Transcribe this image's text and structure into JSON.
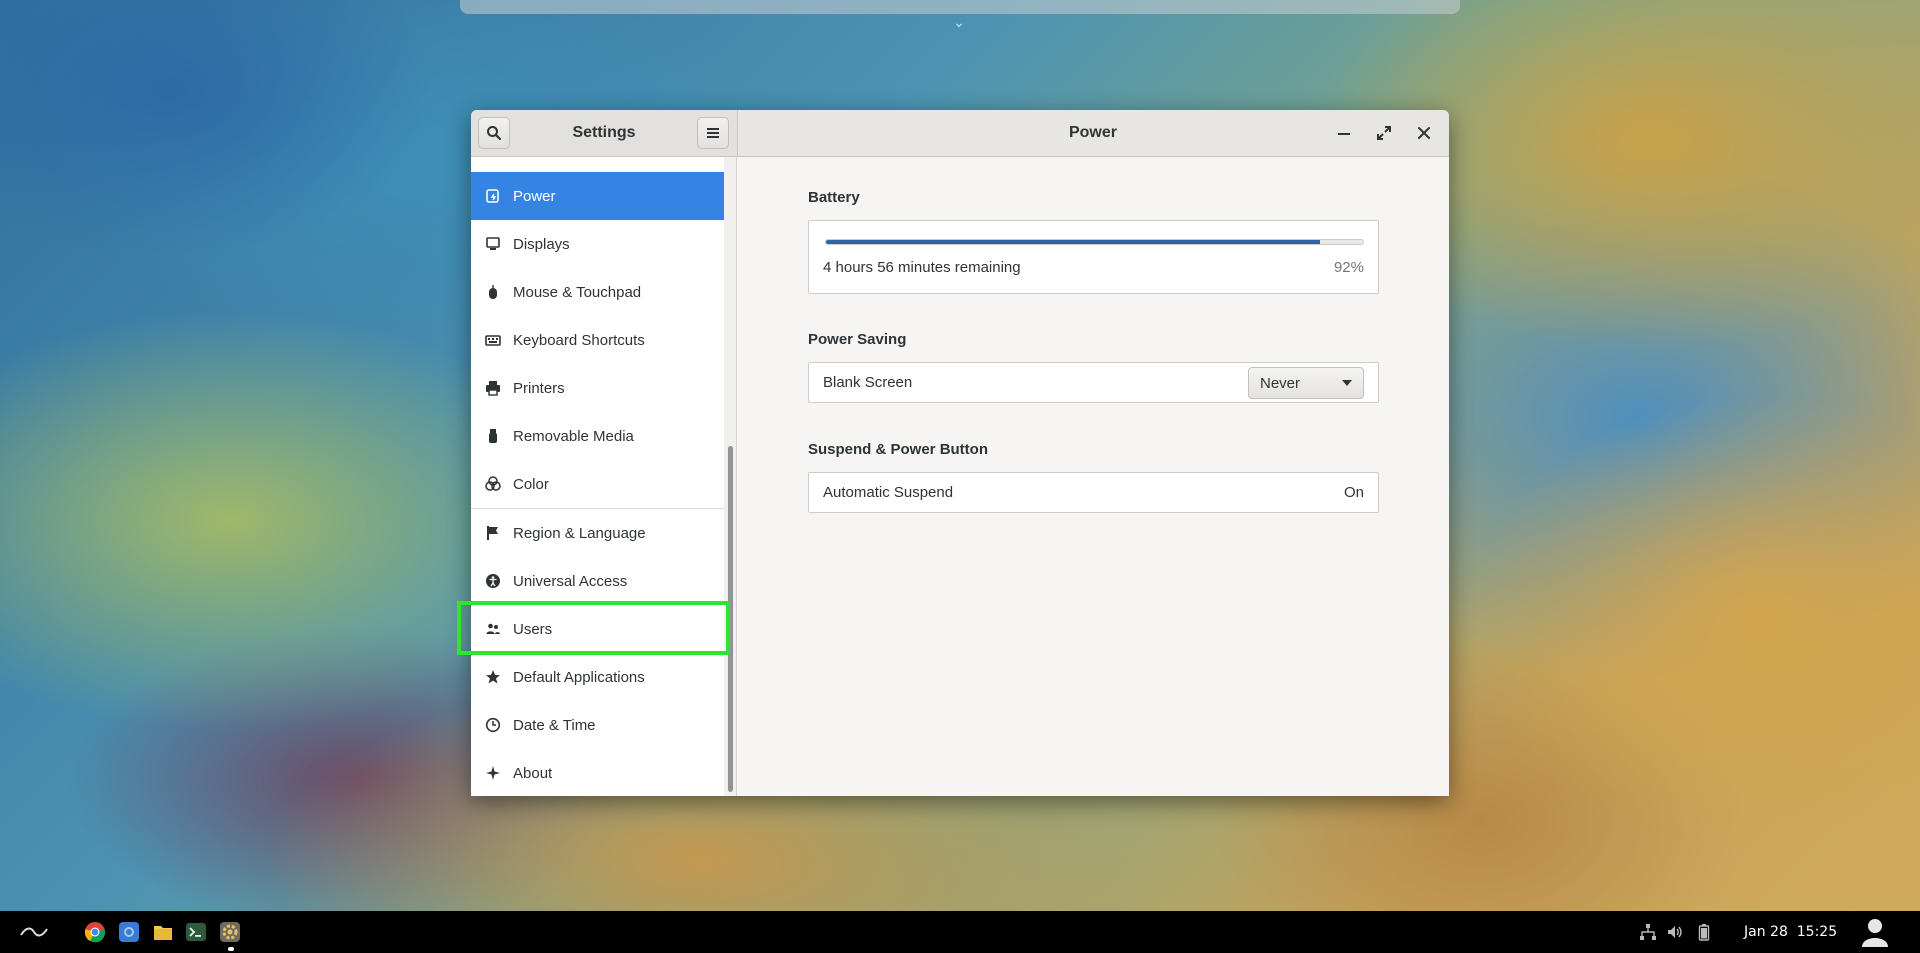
{
  "window": {
    "sidebar_title": "Settings",
    "panel_title": "Power"
  },
  "sidebar": {
    "items": [
      {
        "label": "Power",
        "icon": "power-settings-icon",
        "active": true
      },
      {
        "label": "Displays",
        "icon": "display-icon"
      },
      {
        "label": "Mouse & Touchpad",
        "icon": "mouse-icon"
      },
      {
        "label": "Keyboard Shortcuts",
        "icon": "keyboard-icon"
      },
      {
        "label": "Printers",
        "icon": "printer-icon"
      },
      {
        "label": "Removable Media",
        "icon": "usb-media-icon"
      },
      {
        "label": "Color",
        "icon": "color-icon"
      },
      {
        "label": "Region & Language",
        "icon": "flag-icon"
      },
      {
        "label": "Universal Access",
        "icon": "accessibility-icon"
      },
      {
        "label": "Users",
        "icon": "users-icon",
        "highlighted": true
      },
      {
        "label": "Default Applications",
        "icon": "star-icon"
      },
      {
        "label": "Date & Time",
        "icon": "clock-icon"
      },
      {
        "label": "About",
        "icon": "sparkle-icon"
      }
    ]
  },
  "power": {
    "battery": {
      "heading": "Battery",
      "remaining": "4 hours 56 minutes remaining",
      "percent_label": "92%",
      "level": 0.92
    },
    "power_saving": {
      "heading": "Power Saving",
      "blank_screen_label": "Blank Screen",
      "blank_screen_value": "Never"
    },
    "suspend": {
      "heading": "Suspend & Power Button",
      "automatic_suspend_label": "Automatic Suspend",
      "automatic_suspend_value": "On"
    }
  },
  "taskbar": {
    "date": "Jan 28",
    "time": "15:25",
    "apps": [
      "activities-icon",
      "chrome-icon",
      "chromium-icon",
      "files-icon",
      "terminal-icon",
      "settings-icon"
    ],
    "tray": [
      "network-icon",
      "volume-icon",
      "battery-icon",
      "user-avatar-icon"
    ]
  },
  "colors": {
    "accent": "#3584e4",
    "highlight": "#2ee62e",
    "battery_fill": "#2f63a8"
  }
}
